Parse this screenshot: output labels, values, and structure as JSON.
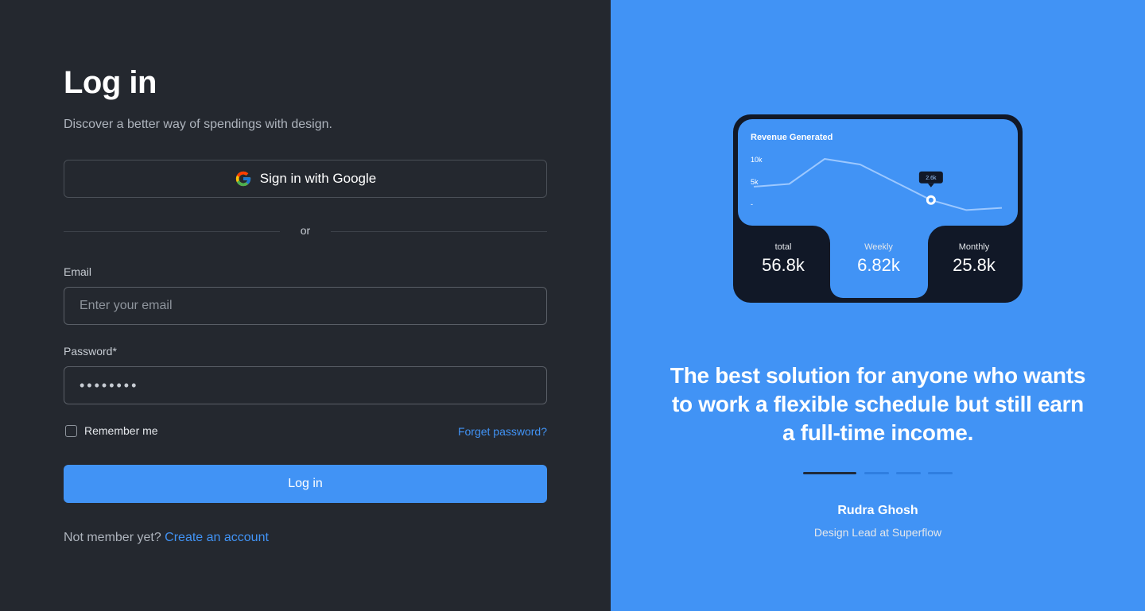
{
  "login": {
    "title": "Log in",
    "subtitle": "Discover a better way of spendings with design.",
    "google_label": "Sign in with Google",
    "divider": "or",
    "email_label": "Email",
    "email_placeholder": "Enter your email",
    "password_label": "Password*",
    "password_value": "••••••••",
    "remember_label": "Remember me",
    "forgot_label": "Forget password?",
    "submit_label": "Log in",
    "signup_prompt": "Not member yet?",
    "signup_link": "Create an account"
  },
  "card": {
    "chart_title": "Revenue Generated",
    "y_ticks": [
      "10k",
      "5k",
      "-"
    ],
    "tooltip": "2.6k",
    "stats": [
      {
        "label": "total",
        "value": "56.8k"
      },
      {
        "label": "Weekly",
        "value": "6.82k"
      },
      {
        "label": "Monthly",
        "value": "25.8k"
      }
    ]
  },
  "chart_data": {
    "type": "line",
    "title": "Revenue Generated",
    "y_tick_labels": [
      "10k",
      "5k",
      "-"
    ],
    "values": [
      5.0,
      5.5,
      10.0,
      9.0,
      5.8,
      2.6,
      0.8,
      1.2
    ],
    "highlight_index": 5,
    "highlight_label": "2.6k",
    "ylim": [
      0,
      10
    ]
  },
  "testimonial": {
    "quote": "The best solution for anyone who wants to work a flexible schedule but still earn a full-time income.",
    "author": "Rudra Ghosh",
    "role": "Design Lead at Superflow",
    "slides": 4,
    "active_slide": 0
  },
  "colors": {
    "brand": "#4193f5",
    "panel_dark": "#24282f",
    "card_dark": "#111827"
  }
}
